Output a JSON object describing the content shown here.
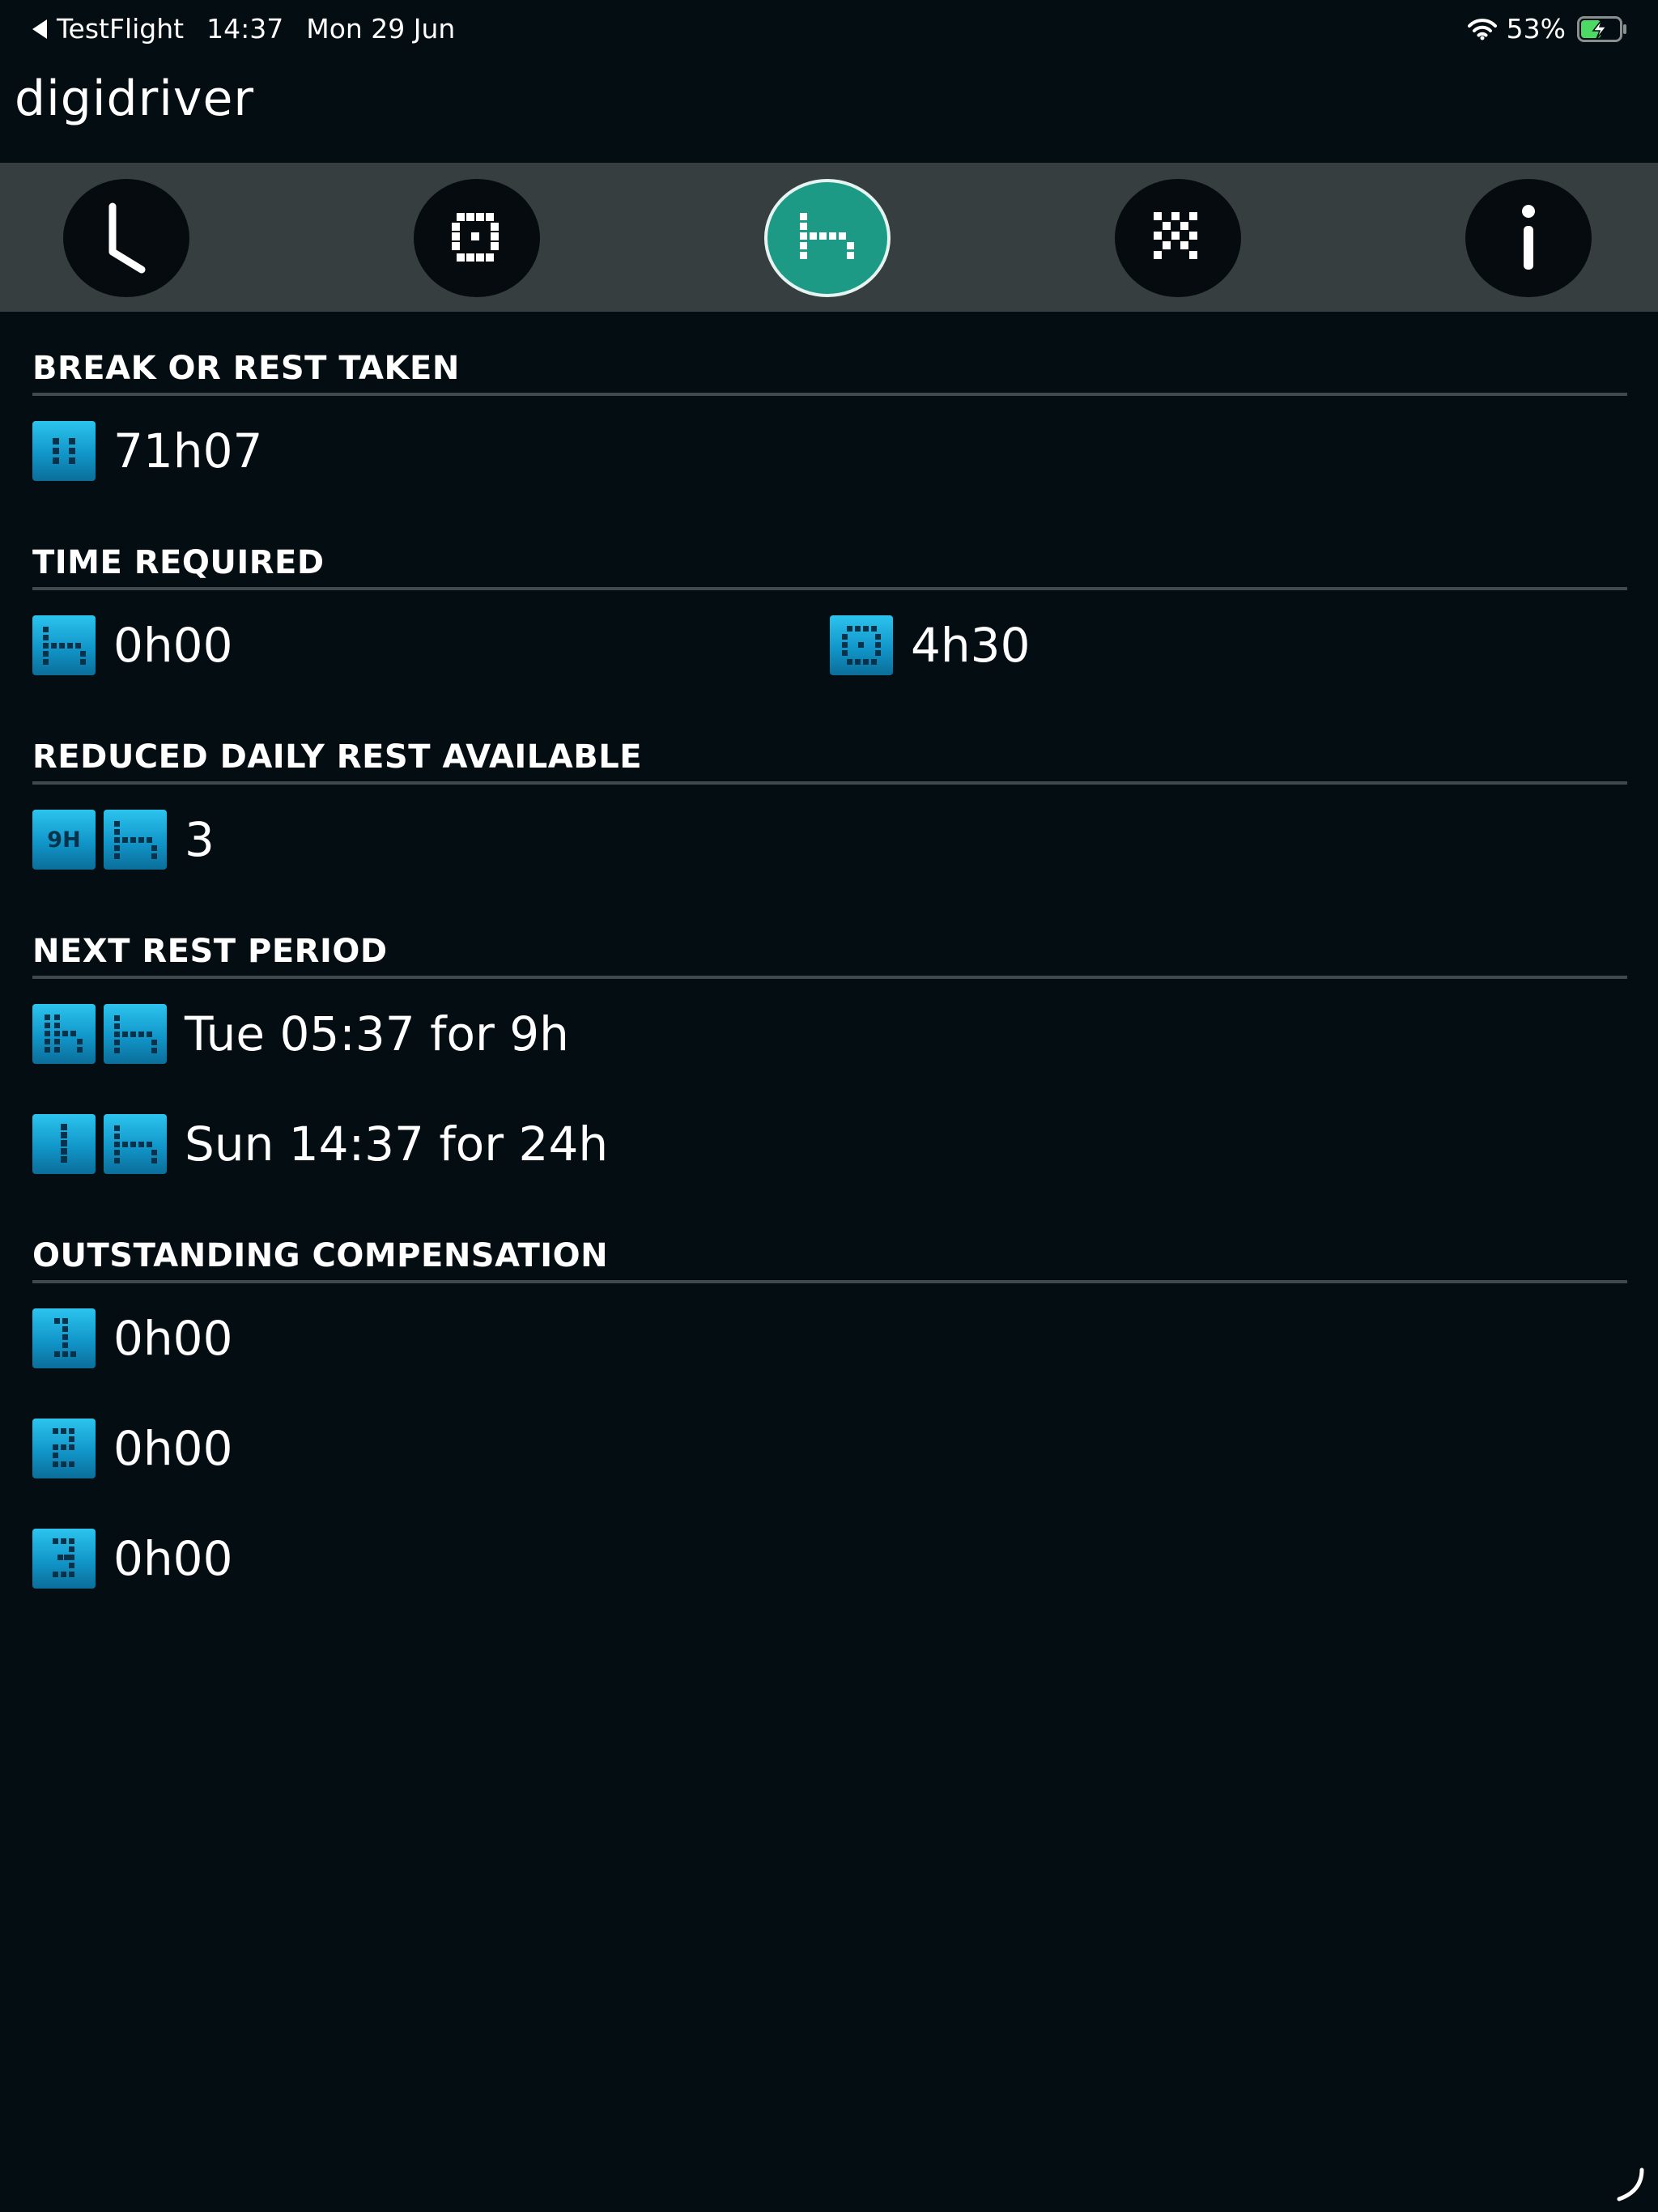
{
  "status_bar": {
    "back_app": "TestFlight",
    "time": "14:37",
    "date": "Mon 29 Jun",
    "battery_percent": "53%",
    "battery_level": 0.53,
    "battery_color": "#4cd964"
  },
  "header": {
    "brand": "digidriver"
  },
  "tabs": [
    {
      "icon": "clock-icon",
      "active": false
    },
    {
      "icon": "work-square-icon",
      "active": false
    },
    {
      "icon": "bed-rest-icon",
      "active": true
    },
    {
      "icon": "crossed-hammers-icon",
      "active": false
    },
    {
      "icon": "info-icon",
      "active": false
    }
  ],
  "colors": {
    "background": "#030d12",
    "tabbar": "#363e3f",
    "active_tab": "#1d9a86",
    "badge": "#1aa9dc"
  },
  "sections": {
    "break_taken": {
      "title": "BREAK OR REST TAKEN",
      "rows": [
        {
          "icon": "break-icon",
          "value": "71h07"
        }
      ]
    },
    "time_required": {
      "title": "TIME REQUIRED",
      "rest": {
        "icon": "bed-rest-icon",
        "value": "0h00"
      },
      "work": {
        "icon": "work-square-icon",
        "value": "4h30"
      }
    },
    "reduced_daily": {
      "title": "REDUCED DAILY REST AVAILABLE",
      "badge_text": "9H",
      "icon": "bed-rest-icon",
      "value": "3"
    },
    "next_rest": {
      "title": "NEXT REST PERIOD",
      "rows": [
        {
          "icons": [
            "daily-rest-icon",
            "bed-rest-icon"
          ],
          "value": "Tue 05:37 for 9h"
        },
        {
          "icons": [
            "weekly-rest-icon",
            "bed-rest-icon"
          ],
          "value": "Sun 14:37 for 24h"
        }
      ]
    },
    "compensation": {
      "title": "OUTSTANDING COMPENSATION",
      "rows": [
        {
          "icon": "digit-1-icon",
          "value": "0h00"
        },
        {
          "icon": "digit-2-icon",
          "value": "0h00"
        },
        {
          "icon": "digit-3-icon",
          "value": "0h00"
        }
      ]
    }
  }
}
